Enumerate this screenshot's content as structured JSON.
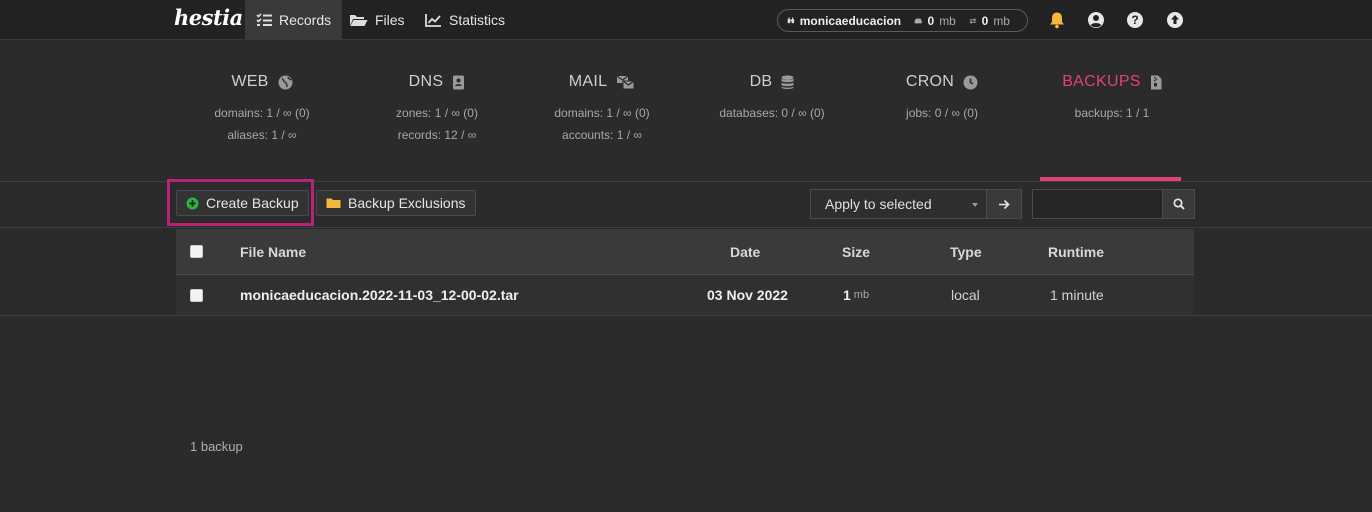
{
  "app": {
    "logo_text": "hestia"
  },
  "nav": {
    "items": [
      {
        "label": "Records",
        "icon": "list-check-icon",
        "active": true
      },
      {
        "label": "Files",
        "icon": "folder-open-icon",
        "active": false
      },
      {
        "label": "Statistics",
        "icon": "chart-line-icon",
        "active": false
      }
    ]
  },
  "user": {
    "name": "monicaeducacion",
    "disk_value": "0",
    "disk_unit": "mb",
    "bandwidth_value": "0",
    "bandwidth_unit": "mb"
  },
  "top_icons": [
    "bell-icon",
    "user-circle-icon",
    "help-icon",
    "upload-icon"
  ],
  "stats": [
    {
      "title": "WEB",
      "icon": "globe-icon",
      "lines": [
        "domains: 1 / ∞ (0)",
        "aliases: 1 / ∞"
      ],
      "active": false
    },
    {
      "title": "DNS",
      "icon": "address-book-icon",
      "lines": [
        "zones: 1 / ∞ (0)",
        "records: 12 / ∞"
      ],
      "active": false
    },
    {
      "title": "MAIL",
      "icon": "mail-bulk-icon",
      "lines": [
        "domains: 1 / ∞ (0)",
        "accounts: 1 / ∞"
      ],
      "active": false
    },
    {
      "title": "DB",
      "icon": "database-icon",
      "lines": [
        "databases: 0 / ∞ (0)"
      ],
      "active": false
    },
    {
      "title": "CRON",
      "icon": "clock-icon",
      "lines": [
        "jobs: 0 / ∞ (0)"
      ],
      "active": false
    },
    {
      "title": "BACKUPS",
      "icon": "file-archive-icon",
      "lines": [
        "backups: 1 / 1"
      ],
      "active": true
    }
  ],
  "toolbar": {
    "create_backup_label": "Create Backup",
    "backup_exclusions_label": "Backup Exclusions",
    "bulk_action_selected": "Apply to selected",
    "search_value": ""
  },
  "table": {
    "columns": [
      "File Name",
      "Date",
      "Size",
      "Type",
      "Runtime"
    ],
    "rows": [
      {
        "file_name": "monicaeducacion.2022-11-03_12-00-02.tar",
        "date": "03 Nov 2022",
        "size_value": "1",
        "size_unit": "mb",
        "type": "local",
        "runtime": "1 minute"
      }
    ]
  },
  "footer": {
    "count_text": "1 backup"
  },
  "colors": {
    "accent": "#e1417a",
    "highlight_box": "#b8237a",
    "create_icon": "#2fb344",
    "folder_icon": "#f5b83d",
    "bell_icon": "#f5b83d"
  }
}
